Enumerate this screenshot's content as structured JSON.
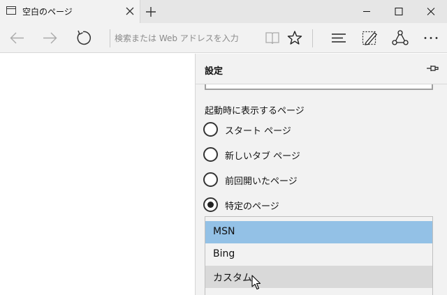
{
  "window": {
    "tab_title": "空白のページ"
  },
  "navbar": {
    "address_placeholder": "検索または Web アドレスを入力"
  },
  "settings": {
    "title": "設定",
    "startup_label": "起動時に表示するページ",
    "options": [
      {
        "label": "スタート ページ",
        "selected": false
      },
      {
        "label": "新しいタブ ページ",
        "selected": false
      },
      {
        "label": "前回開いたページ",
        "selected": false
      },
      {
        "label": "特定のページ",
        "selected": true
      }
    ],
    "dropdown": {
      "options": [
        "MSN",
        "Bing",
        "カスタム"
      ],
      "selected": "MSN",
      "hovered": "カスタム"
    }
  },
  "colors": {
    "selected_option": "#93c1e6",
    "hover_option": "#d9d9d9",
    "chrome": "#f2f2f2"
  },
  "icons": [
    "tab-page-icon",
    "close-icon",
    "plus-icon",
    "minimize-icon",
    "maximize-icon",
    "back-icon",
    "forward-icon",
    "refresh-icon",
    "reading-view-icon",
    "favorite-star-icon",
    "hub-icon",
    "web-note-icon",
    "share-icon",
    "more-icon",
    "pin-icon",
    "mouse-cursor-icon"
  ]
}
